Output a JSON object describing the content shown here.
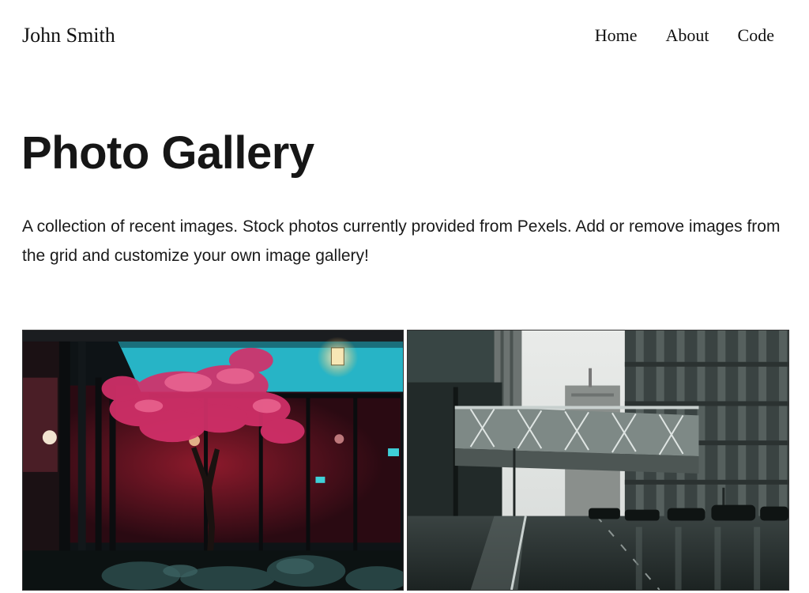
{
  "header": {
    "brand": "John Smith",
    "nav": [
      "Home",
      "About",
      "Code"
    ]
  },
  "main": {
    "title": "Photo Gallery",
    "intro": "A collection of recent images. Stock photos currently provided from Pexels. Add or remove images from the grid and customize your own image gallery!"
  },
  "gallery": {
    "photos": [
      {
        "icon": "photo-tree-neon",
        "accent": "#e0406a"
      },
      {
        "icon": "photo-city-skybridge",
        "accent": "#3b4a48"
      }
    ]
  },
  "colors": {
    "background": "#ffffff",
    "text": "#111111"
  }
}
